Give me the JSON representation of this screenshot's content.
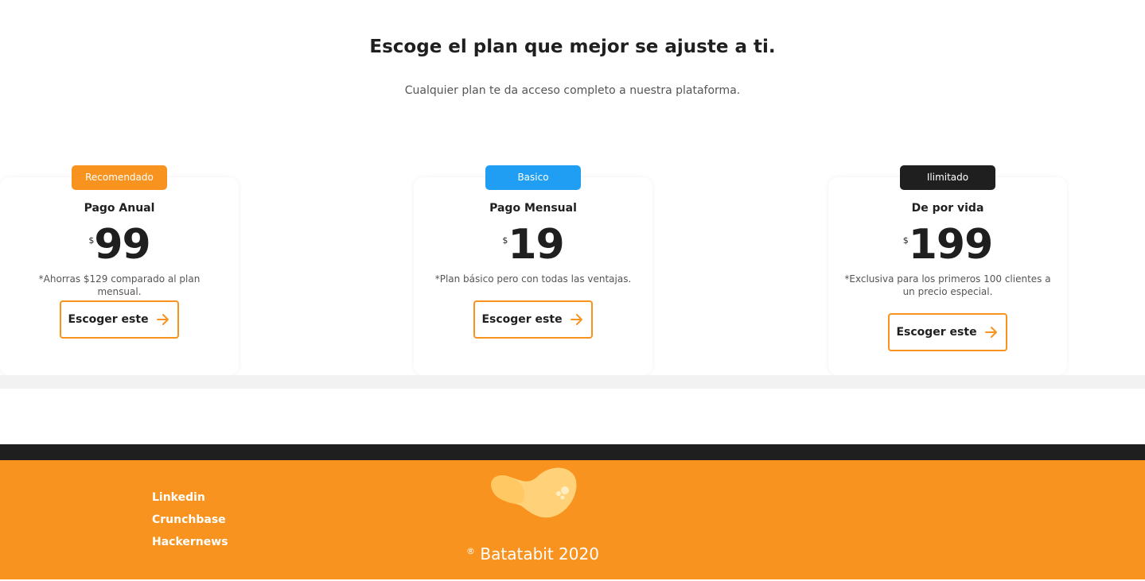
{
  "pricing": {
    "title": "Escoge el plan que mejor se ajuste a ti.",
    "subtitle": "Cualquier plan te da acceso completo a nuestra plataforma.",
    "plans": [
      {
        "badge": "Recomendado",
        "badge_color": "#f7931e",
        "name": "Pago Anual",
        "currency": "$",
        "price": "99",
        "note": "*Ahorras $129 comparado al plan mensual.",
        "button_label": "Escoger este",
        "button_icon": "arrow-right-icon"
      },
      {
        "badge": "Basico",
        "badge_color": "#1f9ef3",
        "name": "Pago Mensual",
        "currency": "$",
        "price": "19",
        "note": "*Plan básico pero con todas las ventajas.",
        "button_label": "Escoger este",
        "button_icon": "arrow-right-icon"
      },
      {
        "badge": "Ilimitado",
        "badge_color": "#1f1f1f",
        "name": "De por vida",
        "currency": "$",
        "price": "199",
        "note": "*Exclusiva para los primeros 100 clientes a un precio especial.",
        "button_label": "Escoger este",
        "button_icon": "arrow-right-icon"
      }
    ]
  },
  "footer": {
    "links": [
      "Linkedin",
      "Crunchbase",
      "Hackernews"
    ],
    "logo_icon": "batatabit-logo-icon",
    "copyright_symbol": "®",
    "copyright_text": "Batatabit 2020",
    "background_color": "#f7931e"
  },
  "colors": {
    "accent": "#f7931e",
    "dark": "#1f1f1f",
    "blue": "#1f9ef3"
  }
}
